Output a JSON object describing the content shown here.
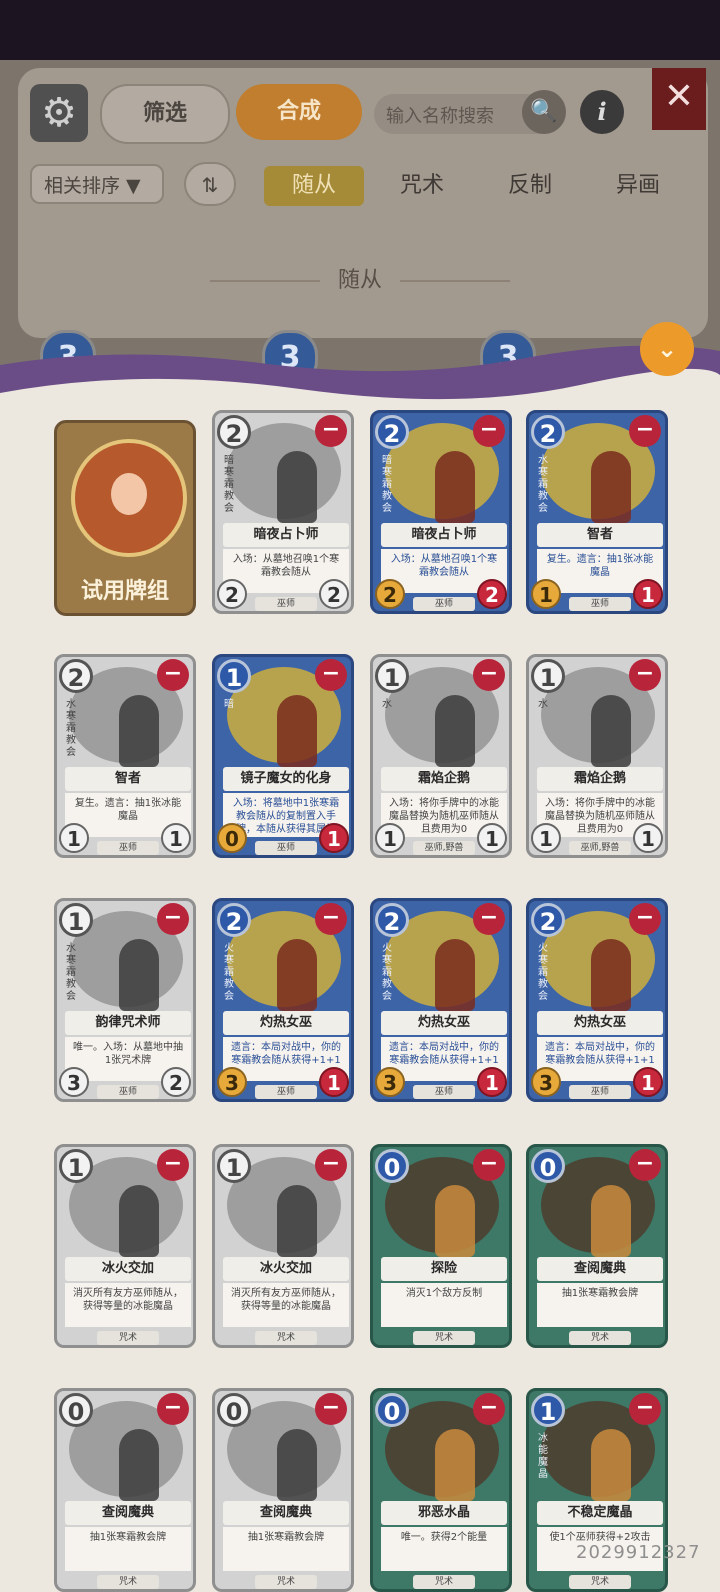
{
  "header": {
    "filter_label": "筛选",
    "compose_label": "合成",
    "search_placeholder": "输入名称搜索",
    "info_glyph": "i",
    "close_glyph": "✕",
    "gear_glyph": "⚙",
    "search_glyph": "🔍"
  },
  "sort": {
    "label": "相关排序 ▼",
    "swap_glyph": "⇅"
  },
  "tabs": [
    {
      "label": "随从",
      "active": true
    },
    {
      "label": "咒术",
      "active": false
    },
    {
      "label": "反制",
      "active": false
    },
    {
      "label": "异画",
      "active": false
    }
  ],
  "section_title": "随从",
  "peek_costs": [
    "3",
    "3",
    "3"
  ],
  "collapse_glyph": "⌄",
  "trial_deck_label": "试用牌组",
  "cards": [
    {
      "cost": "2",
      "name": "暗夜占卜师",
      "side": "暗寒霜教会",
      "desc": "入场：从墓地召唤1个寒霜教会随从",
      "tribe": "巫师",
      "atk": "2",
      "hp": "2",
      "style": "grey"
    },
    {
      "cost": "2",
      "name": "暗夜占卜师",
      "side": "暗寒霜教会",
      "desc": "入场：从墓地召唤1个寒霜教会随从",
      "tribe": "巫师",
      "atk": "2",
      "hp": "2",
      "style": "blue"
    },
    {
      "cost": "2",
      "name": "智者",
      "side": "水寒霜教会",
      "desc": "复生。遗言：抽1张冰能魔晶",
      "tribe": "巫师",
      "atk": "1",
      "hp": "1",
      "style": "blue"
    },
    {
      "cost": "2",
      "name": "智者",
      "side": "水寒霜教会",
      "desc": "复生。遗言：抽1张冰能魔晶",
      "tribe": "巫师",
      "atk": "1",
      "hp": "1",
      "style": "grey"
    },
    {
      "cost": "1",
      "name": "镜子魔女的化身",
      "side": "暗",
      "desc": "入场：将墓地中1张寒霜教会随从的复制置入手牌，本随从获得其属性",
      "tribe": "巫师",
      "atk": "0",
      "hp": "1",
      "style": "blue"
    },
    {
      "cost": "1",
      "name": "霜焰企鹅",
      "side": "水",
      "desc": "入场：将你手牌中的冰能魔晶替换为随机巫师随从且费用为0",
      "tribe": "巫师,野兽",
      "atk": "1",
      "hp": "1",
      "style": "grey"
    },
    {
      "cost": "1",
      "name": "霜焰企鹅",
      "side": "水",
      "desc": "入场：将你手牌中的冰能魔晶替换为随机巫师随从且费用为0",
      "tribe": "巫师,野兽",
      "atk": "1",
      "hp": "1",
      "style": "grey"
    },
    {
      "cost": "1",
      "name": "韵律咒术师",
      "side": "水寒霜教会",
      "desc": "唯一。入场：从墓地中抽1张咒术牌",
      "tribe": "巫师",
      "atk": "3",
      "hp": "2",
      "style": "grey"
    },
    {
      "cost": "2",
      "name": "灼热女巫",
      "side": "火寒霜教会",
      "desc": "遗言：本局对战中，你的寒霜教会随从获得+1+1",
      "tribe": "巫师",
      "atk": "3",
      "hp": "1",
      "style": "blue"
    },
    {
      "cost": "2",
      "name": "灼热女巫",
      "side": "火寒霜教会",
      "desc": "遗言：本局对战中，你的寒霜教会随从获得+1+1",
      "tribe": "巫师",
      "atk": "3",
      "hp": "1",
      "style": "blue"
    },
    {
      "cost": "2",
      "name": "灼热女巫",
      "side": "火寒霜教会",
      "desc": "遗言：本局对战中，你的寒霜教会随从获得+1+1",
      "tribe": "巫师",
      "atk": "3",
      "hp": "1",
      "style": "blue"
    },
    {
      "cost": "1",
      "name": "冰火交加",
      "side": "",
      "desc": "消灭所有友方巫师随从，获得等量的冰能魔晶",
      "tribe": "咒术",
      "atk": "",
      "hp": "",
      "style": "grey"
    },
    {
      "cost": "1",
      "name": "冰火交加",
      "side": "",
      "desc": "消灭所有友方巫师随从，获得等量的冰能魔晶",
      "tribe": "咒术",
      "atk": "",
      "hp": "",
      "style": "grey"
    },
    {
      "cost": "0",
      "name": "探险",
      "side": "",
      "desc": "消灭1个敌方反制",
      "tribe": "咒术",
      "atk": "",
      "hp": "",
      "style": "green"
    },
    {
      "cost": "0",
      "name": "查阅魔典",
      "side": "",
      "desc": "抽1张寒霜教会牌",
      "tribe": "咒术",
      "atk": "",
      "hp": "",
      "style": "green"
    },
    {
      "cost": "0",
      "name": "查阅魔典",
      "side": "",
      "desc": "抽1张寒霜教会牌",
      "tribe": "咒术",
      "atk": "",
      "hp": "",
      "style": "grey"
    },
    {
      "cost": "0",
      "name": "查阅魔典",
      "side": "",
      "desc": "抽1张寒霜教会牌",
      "tribe": "咒术",
      "atk": "",
      "hp": "",
      "style": "grey"
    },
    {
      "cost": "0",
      "name": "邪恶水晶",
      "side": "",
      "desc": "唯一。获得2个能量",
      "tribe": "咒术",
      "atk": "",
      "hp": "",
      "style": "green"
    },
    {
      "cost": "1",
      "name": "不稳定魔晶",
      "side": "冰能魔晶",
      "desc": "使1个巫师获得+2攻击",
      "tribe": "咒术",
      "atk": "",
      "hp": "",
      "style": "green"
    }
  ],
  "watermark": "2029912327"
}
